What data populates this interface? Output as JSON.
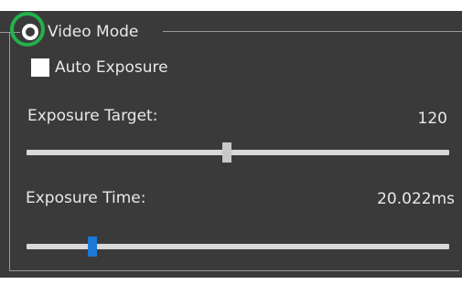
{
  "video_mode": {
    "label": "Video Mode",
    "selected": true
  },
  "auto_exposure": {
    "label": "Auto Exposure",
    "checked": false
  },
  "exposure_target": {
    "label": "Exposure Target:",
    "value_text": "120",
    "slider_fraction": 0.475,
    "thumb_color": "#c8c8c8"
  },
  "exposure_time": {
    "label": "Exposure Time:",
    "value_text": "20.022ms",
    "slider_fraction": 0.155,
    "thumb_color": "#1e78d6"
  },
  "annotation": {
    "highlight_color": "#22b14c"
  }
}
